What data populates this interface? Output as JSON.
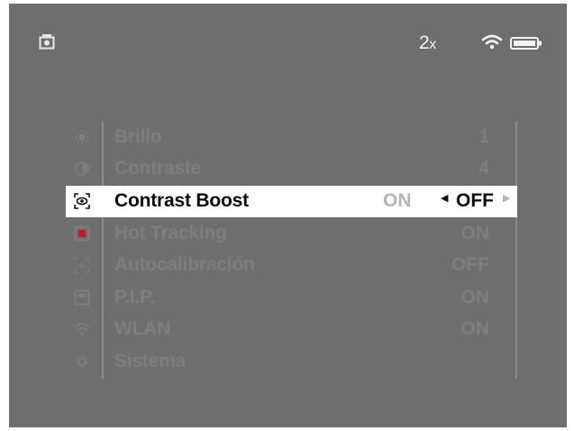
{
  "status_bar": {
    "zoom_value": "2",
    "zoom_unit": "x",
    "icons": [
      "camera-icon",
      "wifi-icon",
      "battery-icon"
    ]
  },
  "menu": {
    "items": [
      {
        "label": "Brillo",
        "value": "1",
        "icon": "brightness-icon"
      },
      {
        "label": "Contraste",
        "value": "4",
        "icon": "contrast-icon"
      },
      {
        "label": "Contrast Boost",
        "icon": "contrast-boost-icon",
        "selected": true,
        "options": [
          "ON",
          "OFF"
        ],
        "current_value": "OFF"
      },
      {
        "label": "Hot Tracking",
        "value": "ON",
        "icon": "hot-tracking-icon"
      },
      {
        "label": "Autocalibración",
        "value": "OFF",
        "icon": "autocalibration-icon"
      },
      {
        "label": "P.I.P.",
        "value": "ON",
        "icon": "pip-icon"
      },
      {
        "label": "WLAN",
        "value": "ON",
        "icon": "wlan-icon"
      },
      {
        "label": "Sistema",
        "value": "",
        "icon": "settings-icon"
      }
    ]
  },
  "colors": {
    "screen_background": "#6e6e6e",
    "inactive_text": "#7d7d7d",
    "selected_background": "#ffffff",
    "selected_text": "#0a0a0a",
    "hot_tracking_icon_accent": "#c8191e"
  }
}
